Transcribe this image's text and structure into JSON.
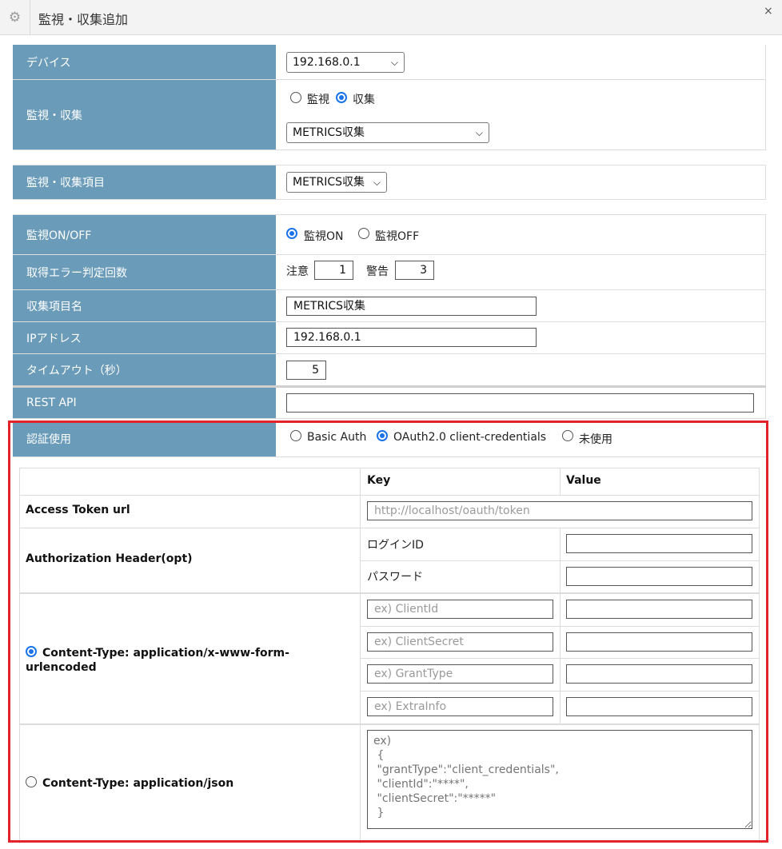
{
  "window": {
    "title": "監視・収集追加",
    "gear_icon": "gear-icon",
    "close_symbol": "×"
  },
  "device": {
    "label": "デバイス",
    "selected": "192.168.0.1"
  },
  "mon_collect": {
    "label": "監視・収集",
    "options": [
      "監視",
      "収集"
    ],
    "selected_option": "収集",
    "type_selected": "METRICS収集"
  },
  "item": {
    "label": "監視・収集項目",
    "selected": "METRICS収集"
  },
  "monitor_onoff": {
    "label": "監視ON/OFF",
    "options": [
      "監視ON",
      "監視OFF"
    ],
    "selected": "監視ON"
  },
  "error_count": {
    "label": "取得エラー判定回数",
    "caution_label": "注意",
    "caution_value": "1",
    "warning_label": "警告",
    "warning_value": "3"
  },
  "item_name": {
    "label": "収集項目名",
    "value": "METRICS収集"
  },
  "ip_address": {
    "label": "IPアドレス",
    "value": "192.168.0.1"
  },
  "timeout": {
    "label": "タイムアウト（秒）",
    "value": "5"
  },
  "rest_api": {
    "label": "REST API",
    "value": ""
  },
  "auth": {
    "label": "認証使用",
    "options": [
      "Basic Auth",
      "OAuth2.0 client-credentials",
      "未使用"
    ],
    "selected": "OAuth2.0 client-credentials"
  },
  "oauth_table": {
    "headers": {
      "key": "Key",
      "value": "Value"
    },
    "access_token": {
      "label": "Access Token url",
      "placeholder": "http://localhost/oauth/token"
    },
    "auth_header": {
      "label": "Authorization Header(opt)",
      "login_id_label": "ログインID",
      "password_label": "パスワード"
    },
    "form_urlencoded": {
      "label": "Content-Type: application/x-www-form-urlencoded",
      "label_line1": "Content-Type: application/x-www-form-",
      "label_line2": "urlencoded",
      "selected": true,
      "key_placeholders": [
        "ex) ClientId",
        "ex) ClientSecret",
        "ex) GrantType",
        "ex) ExtraInfo"
      ]
    },
    "json": {
      "label": "Content-Type: application/json",
      "selected": false,
      "placeholder": "ex)\n {\n \"grantType\":\"client_credentials\",\n \"clientId\":\"****\",\n \"clientSecret\":\"*****\"\n }"
    }
  },
  "colors": {
    "label_bg": "#6a9bb8",
    "highlight_border": "#e3232a",
    "radio_accent": "#1a73e8"
  }
}
